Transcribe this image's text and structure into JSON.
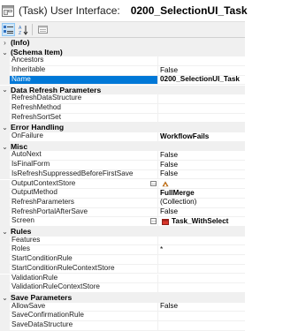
{
  "header": {
    "type_label": "(Task) User Interface:",
    "object_name": "0200_SelectionUI_Task"
  },
  "toolbar": {
    "buttons": [
      "categorized-icon",
      "alphabetical-sort-icon",
      "property-pages-icon"
    ]
  },
  "grid": {
    "rows": [
      {
        "kind": "cat",
        "title": "(Info)",
        "expander": "›"
      },
      {
        "kind": "cat",
        "title": "(Schema Item)",
        "expander": "⌄"
      },
      {
        "kind": "prop",
        "name": "Ancestors",
        "value": ""
      },
      {
        "kind": "prop",
        "name": "Inheritable",
        "value": "False"
      },
      {
        "kind": "prop",
        "name": "Name",
        "value": "0200_SelectionUI_Task",
        "selected": true,
        "bold": true
      },
      {
        "kind": "cat",
        "title": "Data Refresh Parameters",
        "expander": "⌄"
      },
      {
        "kind": "prop",
        "name": "RefreshDataStructure",
        "value": ""
      },
      {
        "kind": "prop",
        "name": "RefreshMethod",
        "value": ""
      },
      {
        "kind": "prop",
        "name": "RefreshSortSet",
        "value": ""
      },
      {
        "kind": "cat",
        "title": "Error Handling",
        "expander": "⌄"
      },
      {
        "kind": "prop",
        "name": "OnFailure",
        "value": "WorkflowFails",
        "bold": true
      },
      {
        "kind": "cat",
        "title": "Misc",
        "expander": "⌄"
      },
      {
        "kind": "prop",
        "name": "AutoNext",
        "value": "False"
      },
      {
        "kind": "prop",
        "name": "IsFinalForm",
        "value": "False"
      },
      {
        "kind": "prop",
        "name": "IsRefreshSuppressedBeforeFirstSave",
        "value": "False"
      },
      {
        "kind": "prop",
        "name": "OutputContextStore",
        "value": "",
        "ellipsis": true,
        "value_icon": "context-store-icon"
      },
      {
        "kind": "prop",
        "name": "OutputMethod",
        "value": "FullMerge",
        "bold": true
      },
      {
        "kind": "prop",
        "name": "RefreshParameters",
        "value": "(Collection)"
      },
      {
        "kind": "prop",
        "name": "RefreshPortalAfterSave",
        "value": "False"
      },
      {
        "kind": "prop",
        "name": "Screen",
        "value": "Task_WithSelect",
        "bold": true,
        "ellipsis": true,
        "value_icon": "screen-icon"
      },
      {
        "kind": "cat",
        "title": "Rules",
        "expander": "⌄"
      },
      {
        "kind": "prop",
        "name": "Features",
        "value": ""
      },
      {
        "kind": "prop",
        "name": "Roles",
        "value": "*"
      },
      {
        "kind": "prop",
        "name": "StartConditionRule",
        "value": ""
      },
      {
        "kind": "prop",
        "name": "StartConditionRuleContextStore",
        "value": ""
      },
      {
        "kind": "prop",
        "name": "ValidationRule",
        "value": ""
      },
      {
        "kind": "prop",
        "name": "ValidationRuleContextStore",
        "value": ""
      },
      {
        "kind": "cat",
        "title": "Save Parameters",
        "expander": "⌄"
      },
      {
        "kind": "prop",
        "name": "AllowSave",
        "value": "False"
      },
      {
        "kind": "prop",
        "name": "SaveConfirmationRule",
        "value": ""
      },
      {
        "kind": "prop",
        "name": "SaveDataStructure",
        "value": ""
      }
    ]
  },
  "colors": {
    "selection": "#0078d7",
    "category_bg": "#f0f0f0",
    "grid_line": "#f0f0f0"
  }
}
